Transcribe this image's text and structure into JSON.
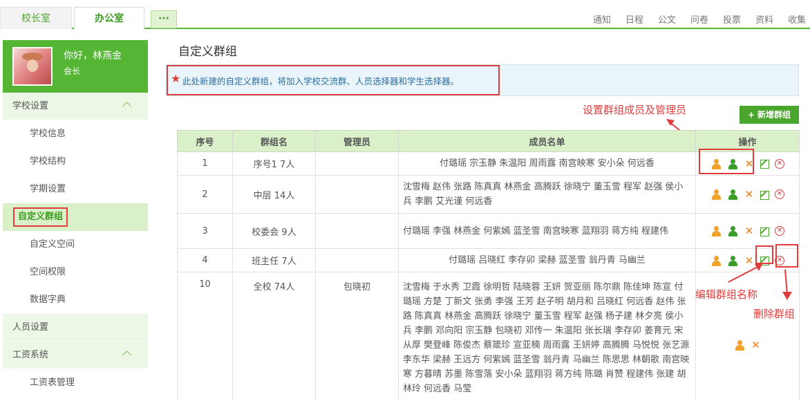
{
  "topbar": {
    "tabs": [
      {
        "label": "校长室"
      },
      {
        "label": "办公室"
      }
    ],
    "more_label": "···",
    "links": [
      "通知",
      "日程",
      "公文",
      "问卷",
      "投票",
      "资料",
      "收集"
    ]
  },
  "profile": {
    "greeting": "你好，林燕金",
    "role": "会长"
  },
  "sidebar": {
    "groups": [
      {
        "label": "学校设置",
        "items": [
          "学校信息",
          "学校结构",
          "学期设置",
          "自定义群组",
          "自定义空间",
          "空间权限",
          "数据字典"
        ]
      },
      {
        "label": "人员设置"
      },
      {
        "label": "工资系统",
        "items": [
          "工资表管理"
        ]
      }
    ]
  },
  "main": {
    "title": "自定义群组",
    "notice_star": "★",
    "notice": "此处新建的自定义群组，将加入学校交流群、人员选择器和学生选择器。",
    "add_button": "新增群组",
    "add_plus": "+",
    "annotations": {
      "members": "设置群组成员及管理员",
      "edit": "编辑群组名称",
      "delete": "删除群组"
    },
    "table": {
      "headers": [
        "序号",
        "群组名",
        "管理员",
        "成员名单",
        "操作"
      ],
      "rows": [
        {
          "no": "1",
          "name": "序号1 7人",
          "admin": "",
          "members": "付璐瑶  宗玉静  朱温阳  周雨露  南宫映寒  安小朵  何远香"
        },
        {
          "no": "2",
          "name": "中层 14人",
          "admin": "",
          "members": "沈雪梅  赵伟  张路  陈真真  林燕金  高腾跃  徐晓宁  董玉雪  程军  赵强  侯小兵  李鹏  艾光谨  何远香"
        },
        {
          "no": "3",
          "name": "校委会 9人",
          "admin": "",
          "members": "付璐瑶  李强  林燕金  何紫嫣  蓝圣雪  南宫映寒  蓝翔羽  蒋方纯  程建伟"
        },
        {
          "no": "4",
          "name": "班主任 7人",
          "admin": "",
          "members": "付璐瑶  吕晓红  李存卯  梁赫  蓝圣雪  翁丹青  马幽兰"
        },
        {
          "no": "10",
          "name": "全校 74人",
          "admin": "包晓初",
          "members": "沈雪梅  于水秀  卫霞  徐明哲  陆晓蓉  王妍  贺亚丽  陈尔鼎  陈佳坤  陈宣  付璐瑶  方楚  丁新文  张勇  李强  王芳  赵子明  胡月和  吕晓红  何远香  赵伟  张路  陈真真  林燕金  高腾跃  徐晓宁  董玉雪  程军  赵强  杨子建  林夕亮  侯小兵  李鹏  邓向阳  宗玉静  包晓初  邓传一  朱温阳  张长瑞  李存卯  姜育元  宋从厚  樊登峰  陈俊杰  蔡箴珍  宣亚楠  周雨露  王妍婷  高腾腾  马悦悦  张艺源  李东华  梁赫  王远方  何紫嫣  蓝圣雪  翁丹青  马幽兰  陈思思  林朝歌  南宫映寒  方暮晴  苏墨  陈雪落  安小朵  蓝翔羽  蒋方纯  陈璐  肖赞  程建伟  张建  胡林玲  何远香  马莹"
        }
      ]
    }
  }
}
